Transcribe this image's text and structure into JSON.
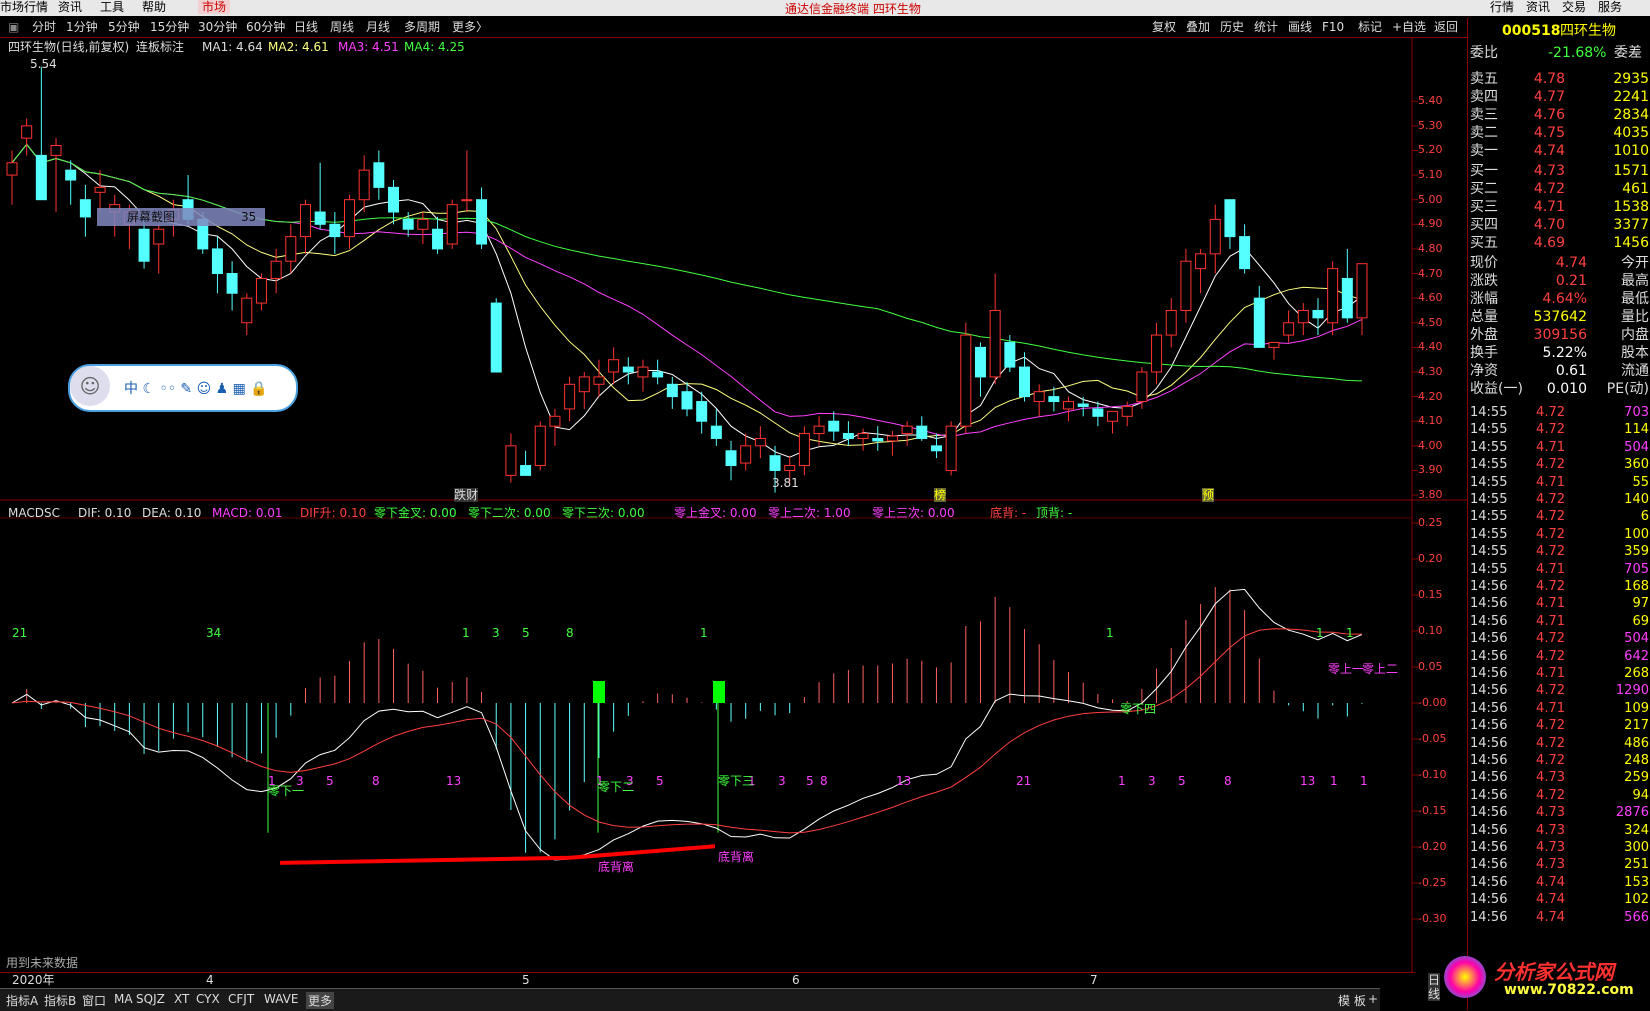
{
  "menubar": {
    "items": [
      "市场行情",
      "资讯",
      "工具",
      "帮助"
    ],
    "active": "市场",
    "title": "通达信金融终端  四环生物",
    "right_items": [
      "行情",
      "资讯",
      "交易",
      "服务"
    ]
  },
  "toolbar": {
    "periods": [
      "分时",
      "1分钟",
      "5分钟",
      "15分钟",
      "30分钟",
      "60分钟",
      "日线",
      "周线",
      "月线",
      "多周期",
      "更多〉"
    ],
    "right": [
      "复权",
      "叠加",
      "历史",
      "统计",
      "画线",
      "F10",
      "标记",
      "+自选",
      "返回"
    ]
  },
  "main_legend": {
    "stock": "四环生物(日线,前复权)",
    "indicator": "连板标注",
    "ma1": "MA1: 4.64",
    "ma2": "MA2: 4.61",
    "ma3": "MA3: 4.51",
    "ma4": "MA4: 4.25"
  },
  "main_axis": [
    "5.40",
    "5.30",
    "5.20",
    "5.10",
    "5.00",
    "4.90",
    "4.80",
    "4.70",
    "4.60",
    "4.50",
    "4.40",
    "4.30",
    "4.20",
    "4.10",
    "4.00",
    "3.90",
    "3.80"
  ],
  "annotations": {
    "high": "5.54",
    "low": "3.81",
    "screenshot": "屏幕截图",
    "screenshot_num": "35",
    "marks": [
      "跌财",
      "榜",
      "预"
    ]
  },
  "macd_legend": {
    "name": "MACDSC",
    "dif": "DIF: 0.10",
    "dea": "DEA: 0.10",
    "macd": "MACD: 0.01",
    "dif_up": "DIF升: 0.10",
    "zero_below_gold": "零下金叉: 0.00",
    "zero_below_2": "零下二次: 0.00",
    "zero_below_3": "零下三次: 0.00",
    "zero_above_gold": "零上金叉: 0.00",
    "zero_above_2": "零上二次: 1.00",
    "zero_above_3": "零上三次: 0.00",
    "bottom_div": "底背: -",
    "top_div": "顶背: -"
  },
  "macd_axis": [
    "0.25",
    "0.20",
    "0.15",
    "0.10",
    "0.05",
    "-0.00",
    "-0.05",
    "-0.10",
    "-0.15",
    "-0.20",
    "-0.25",
    "-0.30"
  ],
  "macd_labels": {
    "top_counts": [
      "21",
      "34",
      "1",
      "3",
      "5",
      "8",
      "1",
      "1",
      "1",
      "1"
    ],
    "bottom_counts": [
      "1",
      "3",
      "5",
      "8",
      "13",
      "1",
      "3",
      "5",
      "1",
      "3",
      "5",
      "8",
      "13",
      "21",
      "1",
      "3",
      "5",
      "8",
      "13",
      "1",
      "1"
    ],
    "zero_below_1": "零下一",
    "zero_below_2": "零下二",
    "zero_below_3": "零下三",
    "zero_below_4": "零下四",
    "zero_above_1": "零上一",
    "zero_above_2": "零上二",
    "bottom_rise_1": "底背离",
    "bottom_rise_2": "底背离",
    "future_data": "用到未来数据"
  },
  "datebar": {
    "labels": [
      "2020年",
      "4",
      "5",
      "6",
      "7"
    ],
    "right": "日线"
  },
  "bottombar": {
    "tabs": [
      "指标A",
      "指标B",
      "窗口",
      "MA",
      "SQJZ",
      "XT",
      "CYX",
      "CFJT",
      "WAVE",
      "更多"
    ],
    "right": [
      "模 板",
      "+"
    ]
  },
  "quote": {
    "code": "000518",
    "name": "四环生物",
    "weibi_label": "委比",
    "weibi": "-21.68%",
    "weicha_label": "委差",
    "asks": [
      {
        "label": "卖五",
        "price": "4.78",
        "vol": "2935"
      },
      {
        "label": "卖四",
        "price": "4.77",
        "vol": "2241"
      },
      {
        "label": "卖三",
        "price": "4.76",
        "vol": "2834"
      },
      {
        "label": "卖二",
        "price": "4.75",
        "vol": "4035"
      },
      {
        "label": "卖一",
        "price": "4.74",
        "vol": "1010"
      }
    ],
    "bids": [
      {
        "label": "买一",
        "price": "4.73",
        "vol": "1571"
      },
      {
        "label": "买二",
        "price": "4.72",
        "vol": "461"
      },
      {
        "label": "买三",
        "price": "4.71",
        "vol": "1538"
      },
      {
        "label": "买四",
        "price": "4.70",
        "vol": "3377"
      },
      {
        "label": "买五",
        "price": "4.69",
        "vol": "1456"
      }
    ],
    "stats": [
      {
        "l1": "现价",
        "v1": "4.74",
        "l2": "今开",
        "c": "#ff4040"
      },
      {
        "l1": "涨跌",
        "v1": "0.21",
        "l2": "最高",
        "c": "#ff4040"
      },
      {
        "l1": "涨幅",
        "v1": "4.64%",
        "l2": "最低",
        "c": "#ff4040"
      },
      {
        "l1": "总量",
        "v1": "537642",
        "l2": "量比",
        "c": "#ffff00"
      },
      {
        "l1": "外盘",
        "v1": "309156",
        "l2": "内盘",
        "c": "#ff4040"
      },
      {
        "l1": "换手",
        "v1": "5.22%",
        "l2": "股本",
        "c": "#ffffff"
      },
      {
        "l1": "净资",
        "v1": "0.61",
        "l2": "流通",
        "c": "#ffffff"
      },
      {
        "l1": "收益(一)",
        "v1": "0.010",
        "l2": "PE(动)",
        "c": "#ffffff"
      }
    ],
    "ticks": [
      {
        "t": "14:55",
        "p": "4.72",
        "v": "703",
        "c": "#ff40ff"
      },
      {
        "t": "14:55",
        "p": "4.72",
        "v": "114",
        "c": "#ffff00"
      },
      {
        "t": "14:55",
        "p": "4.71",
        "v": "504",
        "c": "#ff40ff"
      },
      {
        "t": "14:55",
        "p": "4.72",
        "v": "360",
        "c": "#ffff00"
      },
      {
        "t": "14:55",
        "p": "4.71",
        "v": "55",
        "c": "#ffff00"
      },
      {
        "t": "14:55",
        "p": "4.72",
        "v": "140",
        "c": "#ffff00"
      },
      {
        "t": "14:55",
        "p": "4.72",
        "v": "6",
        "c": "#ffff00"
      },
      {
        "t": "14:55",
        "p": "4.72",
        "v": "100",
        "c": "#ffff00"
      },
      {
        "t": "14:55",
        "p": "4.72",
        "v": "359",
        "c": "#ffff00"
      },
      {
        "t": "14:55",
        "p": "4.71",
        "v": "705",
        "c": "#ff40ff"
      },
      {
        "t": "14:56",
        "p": "4.72",
        "v": "168",
        "c": "#ffff00"
      },
      {
        "t": "14:56",
        "p": "4.71",
        "v": "97",
        "c": "#ffff00"
      },
      {
        "t": "14:56",
        "p": "4.71",
        "v": "69",
        "c": "#ffff00"
      },
      {
        "t": "14:56",
        "p": "4.72",
        "v": "504",
        "c": "#ff40ff"
      },
      {
        "t": "14:56",
        "p": "4.72",
        "v": "642",
        "c": "#ff40ff"
      },
      {
        "t": "14:56",
        "p": "4.71",
        "v": "268",
        "c": "#ffff00"
      },
      {
        "t": "14:56",
        "p": "4.72",
        "v": "1290",
        "c": "#ff40ff"
      },
      {
        "t": "14:56",
        "p": "4.71",
        "v": "109",
        "c": "#ffff00"
      },
      {
        "t": "14:56",
        "p": "4.72",
        "v": "217",
        "c": "#ffff00"
      },
      {
        "t": "14:56",
        "p": "4.72",
        "v": "486",
        "c": "#ffff00"
      },
      {
        "t": "14:56",
        "p": "4.72",
        "v": "248",
        "c": "#ffff00"
      },
      {
        "t": "14:56",
        "p": "4.73",
        "v": "259",
        "c": "#ffff00"
      },
      {
        "t": "14:56",
        "p": "4.72",
        "v": "94",
        "c": "#ffff00"
      },
      {
        "t": "14:56",
        "p": "4.73",
        "v": "2876",
        "c": "#ff40ff"
      },
      {
        "t": "14:56",
        "p": "4.73",
        "v": "324",
        "c": "#ffff00"
      },
      {
        "t": "14:56",
        "p": "4.73",
        "v": "300",
        "c": "#ffff00"
      },
      {
        "t": "14:56",
        "p": "4.73",
        "v": "251",
        "c": "#ffff00"
      },
      {
        "t": "14:56",
        "p": "4.74",
        "v": "153",
        "c": "#ffff00"
      },
      {
        "t": "14:56",
        "p": "4.74",
        "v": "102",
        "c": "#ffff00"
      },
      {
        "t": "14:56",
        "p": "4.74",
        "v": "566",
        "c": "#ff40ff"
      }
    ]
  },
  "watermark": {
    "cn": "分析家公式网",
    "url": "www.70822.com"
  },
  "chart_data": {
    "type": "candlestick",
    "ohlc": [
      [
        5.1,
        5.2,
        4.98,
        5.15
      ],
      [
        5.25,
        5.33,
        5.18,
        5.3
      ],
      [
        5.18,
        5.54,
        5.05,
        5.0
      ],
      [
        5.18,
        5.25,
        4.95,
        5.22
      ],
      [
        5.12,
        5.16,
        4.98,
        5.08
      ],
      [
        5.0,
        5.06,
        4.85,
        4.93
      ],
      [
        5.03,
        5.12,
        4.95,
        5.05
      ],
      [
        4.95,
        5.02,
        4.85,
        4.98
      ],
      [
        4.9,
        4.98,
        4.8,
        4.95
      ],
      [
        4.88,
        4.92,
        4.72,
        4.75
      ],
      [
        4.82,
        4.9,
        4.7,
        4.88
      ],
      [
        4.92,
        5.0,
        4.85,
        4.96
      ],
      [
        5.0,
        5.1,
        4.9,
        4.92
      ],
      [
        4.92,
        4.95,
        4.78,
        4.8
      ],
      [
        4.8,
        4.85,
        4.62,
        4.7
      ],
      [
        4.7,
        4.75,
        4.55,
        4.62
      ],
      [
        4.5,
        4.62,
        4.45,
        4.6
      ],
      [
        4.58,
        4.7,
        4.55,
        4.68
      ],
      [
        4.68,
        4.8,
        4.62,
        4.75
      ],
      [
        4.75,
        4.9,
        4.7,
        4.85
      ],
      [
        4.85,
        5.0,
        4.78,
        4.98
      ],
      [
        4.95,
        5.15,
        4.88,
        4.9
      ],
      [
        4.9,
        4.95,
        4.78,
        4.85
      ],
      [
        4.85,
        5.02,
        4.8,
        5.0
      ],
      [
        5.0,
        5.18,
        4.95,
        5.12
      ],
      [
        5.15,
        5.2,
        5.0,
        5.05
      ],
      [
        5.05,
        5.08,
        4.9,
        4.95
      ],
      [
        4.92,
        4.95,
        4.85,
        4.88
      ],
      [
        4.88,
        4.95,
        4.82,
        4.92
      ],
      [
        4.88,
        4.93,
        4.78,
        4.8
      ],
      [
        4.82,
        5.0,
        4.8,
        4.98
      ],
      [
        5.0,
        5.2,
        4.95,
        5.0
      ],
      [
        5.0,
        5.05,
        4.8,
        4.82
      ],
      [
        4.58,
        4.6,
        4.3,
        4.3
      ],
      [
        3.88,
        4.05,
        3.85,
        4.0
      ],
      [
        3.92,
        3.98,
        3.88,
        3.88
      ],
      [
        3.92,
        4.1,
        3.9,
        4.08
      ],
      [
        4.08,
        4.15,
        4.0,
        4.12
      ],
      [
        4.15,
        4.28,
        4.1,
        4.25
      ],
      [
        4.22,
        4.3,
        4.15,
        4.28
      ],
      [
        4.25,
        4.35,
        4.2,
        4.28
      ],
      [
        4.3,
        4.4,
        4.25,
        4.35
      ],
      [
        4.32,
        4.36,
        4.25,
        4.3
      ],
      [
        4.28,
        4.35,
        4.22,
        4.32
      ],
      [
        4.3,
        4.35,
        4.25,
        4.28
      ],
      [
        4.25,
        4.28,
        4.15,
        4.2
      ],
      [
        4.22,
        4.26,
        4.12,
        4.15
      ],
      [
        4.18,
        4.22,
        4.05,
        4.1
      ],
      [
        4.08,
        4.15,
        4.0,
        4.03
      ],
      [
        3.98,
        4.02,
        3.86,
        3.92
      ],
      [
        3.93,
        4.05,
        3.9,
        4.0
      ],
      [
        4.0,
        4.08,
        3.95,
        4.03
      ],
      [
        3.96,
        4.0,
        3.81,
        3.9
      ],
      [
        3.9,
        3.96,
        3.85,
        3.92
      ],
      [
        3.92,
        4.08,
        3.88,
        4.05
      ],
      [
        4.05,
        4.12,
        4.0,
        4.08
      ],
      [
        4.1,
        4.14,
        4.02,
        4.06
      ],
      [
        4.05,
        4.1,
        4.0,
        4.03
      ],
      [
        4.03,
        4.07,
        3.98,
        4.05
      ],
      [
        4.03,
        4.08,
        3.98,
        4.02
      ],
      [
        4.02,
        4.06,
        3.96,
        4.04
      ],
      [
        4.05,
        4.1,
        4.0,
        4.08
      ],
      [
        4.08,
        4.12,
        4.02,
        4.03
      ],
      [
        4.0,
        4.05,
        3.95,
        3.98
      ],
      [
        3.9,
        4.1,
        3.88,
        4.08
      ],
      [
        4.08,
        4.5,
        4.05,
        4.45
      ],
      [
        4.4,
        4.42,
        4.2,
        4.28
      ],
      [
        4.28,
        4.7,
        4.25,
        4.55
      ],
      [
        4.42,
        4.45,
        4.3,
        4.32
      ],
      [
        4.32,
        4.38,
        4.18,
        4.2
      ],
      [
        4.18,
        4.25,
        4.12,
        4.22
      ],
      [
        4.2,
        4.24,
        4.14,
        4.18
      ],
      [
        4.15,
        4.2,
        4.1,
        4.18
      ],
      [
        4.17,
        4.2,
        4.12,
        4.16
      ],
      [
        4.15,
        4.18,
        4.08,
        4.12
      ],
      [
        4.1,
        4.12,
        4.05,
        4.14
      ],
      [
        4.12,
        4.18,
        4.08,
        4.16
      ],
      [
        4.18,
        4.32,
        4.15,
        4.3
      ],
      [
        4.3,
        4.5,
        4.25,
        4.45
      ],
      [
        4.45,
        4.6,
        4.4,
        4.55
      ],
      [
        4.55,
        4.8,
        4.5,
        4.75
      ],
      [
        4.72,
        4.8,
        4.62,
        4.78
      ],
      [
        4.78,
        4.98,
        4.7,
        4.92
      ],
      [
        5.0,
        5.0,
        4.8,
        4.85
      ],
      [
        4.85,
        4.9,
        4.7,
        4.72
      ],
      [
        4.6,
        4.65,
        4.4,
        4.4
      ],
      [
        4.4,
        4.42,
        4.35,
        4.42
      ],
      [
        4.45,
        4.55,
        4.42,
        4.5
      ],
      [
        4.5,
        4.58,
        4.45,
        4.55
      ],
      [
        4.55,
        4.6,
        4.45,
        4.52
      ],
      [
        4.5,
        4.75,
        4.45,
        4.72
      ],
      [
        4.68,
        4.8,
        4.5,
        4.52
      ],
      [
        4.52,
        4.74,
        4.45,
        4.74
      ]
    ],
    "ma_series": [
      "MA1",
      "MA2",
      "MA3",
      "MA4"
    ],
    "macd": {
      "dif": 0.1,
      "dea": 0.1,
      "macd": 0.01
    }
  }
}
